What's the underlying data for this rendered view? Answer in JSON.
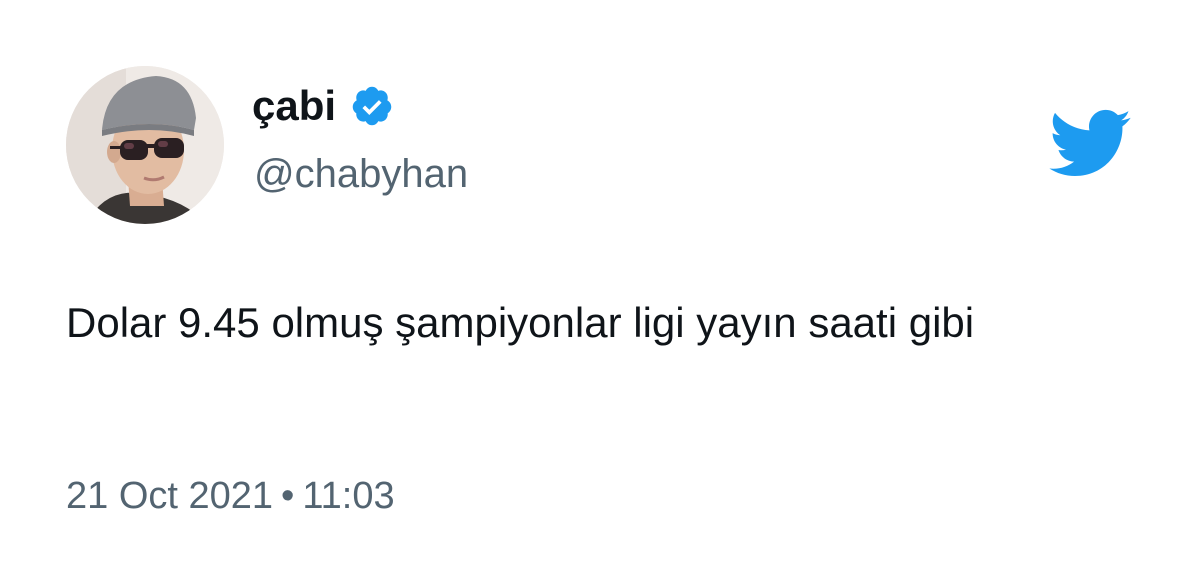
{
  "author": {
    "display_name": "çabi",
    "handle": "@chabyhan",
    "verified": true,
    "avatar_icon": "avatar-photo",
    "verified_icon": "verified-badge-icon",
    "verified_color": "#1d9bf0"
  },
  "tweet": {
    "text": "Dolar 9.45 olmuş şampiyonlar ligi yayın saati gibi",
    "date": "21 Oct 2021",
    "separator": "•",
    "time": "11:03"
  },
  "brand": {
    "icon": "twitter-bird-icon",
    "color": "#1d9bf0"
  },
  "colors": {
    "text_primary": "#0f1419",
    "text_secondary": "#536471",
    "background": "#ffffff"
  }
}
